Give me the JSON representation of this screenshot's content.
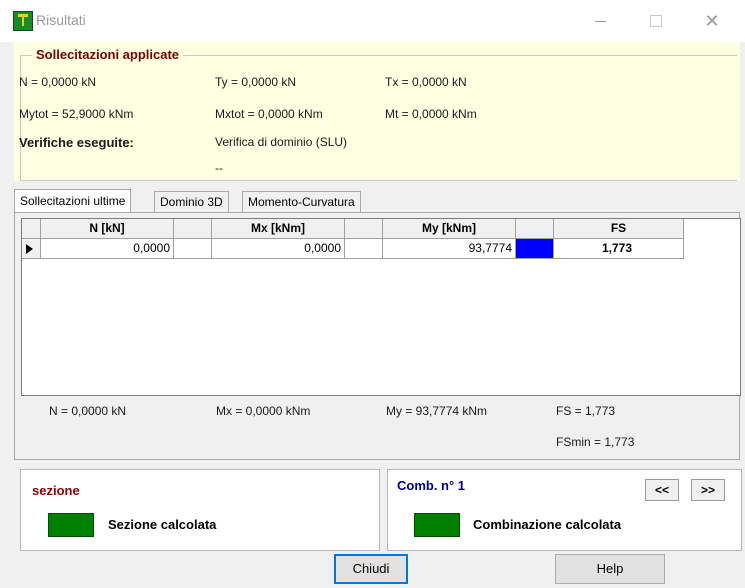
{
  "window": {
    "title": "Risultati"
  },
  "applied": {
    "legend": "Sollecitazioni applicate",
    "n": "N = 0,0000 kN",
    "ty": "Ty = 0,0000 kN",
    "tx": "Tx = 0,0000 kN",
    "mytot": "Mytot = 52,9000 kNm",
    "mxtot": "Mxtot = 0,0000 kNm",
    "mt": "Mt = 0,0000 kNm",
    "verifiche_label": "Verifiche eseguite:",
    "verifica_value": "Verifica di dominio (SLU)",
    "extra": "--"
  },
  "tabs": [
    "Sollecitazioni ultime",
    "Dominio 3D",
    "Momento-Curvatura"
  ],
  "grid": {
    "headers": [
      "N [kN]",
      "Mx [kNm]",
      "My [kNm]",
      "FS"
    ],
    "row": {
      "n": "0,0000",
      "mx": "0,0000",
      "my": "93,7774",
      "fs": "1,773"
    },
    "fs_color": "#0000ff"
  },
  "summary": {
    "n": "N = 0,0000 kN",
    "mx": "Mx = 0,0000 kNm",
    "my": "My = 93,7774 kNm",
    "fs": "FS = 1,773",
    "fsmin": "FSmin = 1,773"
  },
  "sezione": {
    "label": "sezione",
    "status": "Sezione calcolata",
    "color": "#008000"
  },
  "combinazione": {
    "label": "Comb. n° 1",
    "status": "Combinazione calcolata",
    "prev": "<<",
    "next": ">>",
    "color": "#008000"
  },
  "buttons": {
    "close": "Chiudi",
    "help": "Help"
  }
}
